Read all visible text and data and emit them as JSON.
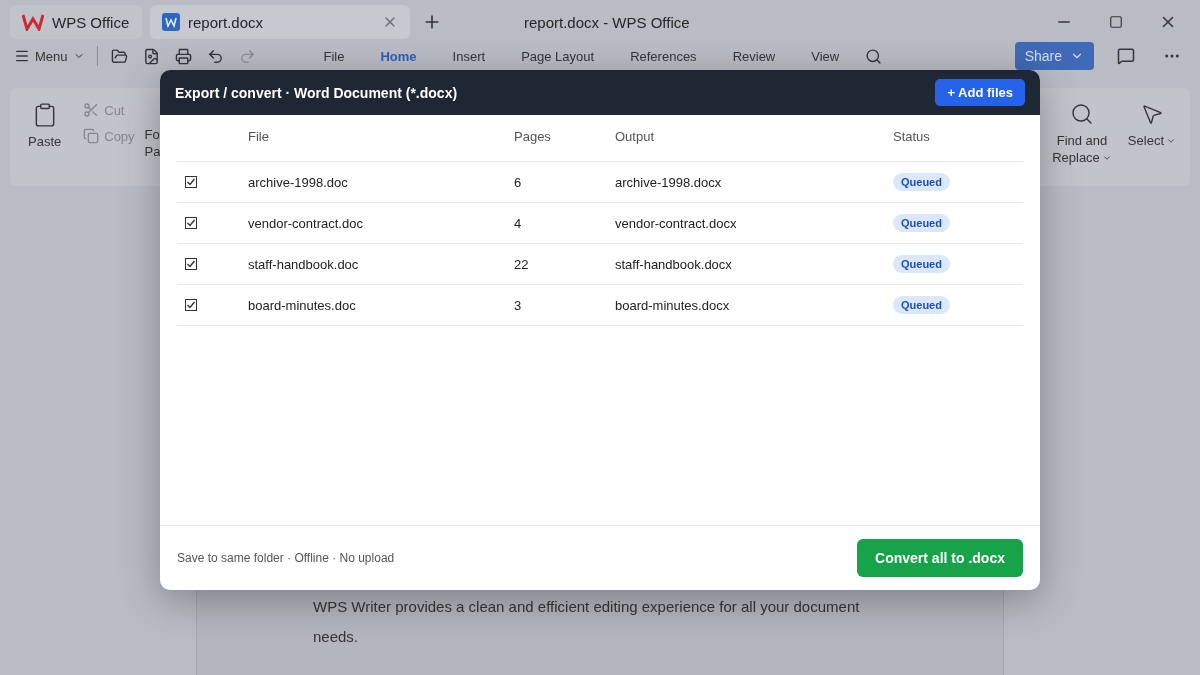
{
  "title_bar": {
    "tabs": [
      {
        "kind": "home",
        "label": "WPS Office",
        "selected": false
      },
      {
        "kind": "document",
        "label": "report.docx",
        "selected": true
      }
    ],
    "title": "report.docx - WPS Office"
  },
  "toolbar": {
    "menu": "Menu",
    "tabs": [
      {
        "label": "File",
        "selected": false
      },
      {
        "label": "Home",
        "selected": true
      },
      {
        "label": "Insert",
        "selected": false
      },
      {
        "label": "Page Layout",
        "selected": false
      },
      {
        "label": "References",
        "selected": false
      },
      {
        "label": "Review",
        "selected": false
      },
      {
        "label": "View",
        "selected": false
      }
    ],
    "share": "Share"
  },
  "ribbon": {
    "paste": "Paste",
    "small_actions": [
      {
        "kind": "cut",
        "label": "Cut",
        "disabled": true
      },
      {
        "kind": "copy",
        "label": "Copy",
        "disabled": true
      }
    ],
    "format_painter": [
      "Fo",
      "Pa"
    ],
    "right_actions": [
      {
        "kind": "find",
        "lines": [
          "Find and",
          "Replace"
        ]
      },
      {
        "kind": "select",
        "lines": [
          "Select"
        ]
      }
    ]
  },
  "document": {
    "text": "WPS Writer provides a clean and efficient editing experience for all your document needs."
  },
  "dialog": {
    "title": "Export / convert · Word Document (*.docx)",
    "add_button": "+ Add files",
    "columns": [
      "File",
      "Pages",
      "Output",
      "Status"
    ],
    "rows": [
      {
        "checked": true,
        "file": "archive-1998.doc",
        "pages": "6",
        "output": "archive-1998.docx",
        "status": "Queued"
      },
      {
        "checked": true,
        "file": "vendor-contract.doc",
        "pages": "4",
        "output": "vendor-contract.docx",
        "status": "Queued"
      },
      {
        "checked": true,
        "file": "staff-handbook.doc",
        "pages": "22",
        "output": "staff-handbook.docx",
        "status": "Queued"
      },
      {
        "checked": true,
        "file": "board-minutes.doc",
        "pages": "3",
        "output": "board-minutes.docx",
        "status": "Queued"
      }
    ],
    "footer_note": "Save to same folder · Offline · No upload",
    "convert_button": "Convert all to .docx"
  }
}
